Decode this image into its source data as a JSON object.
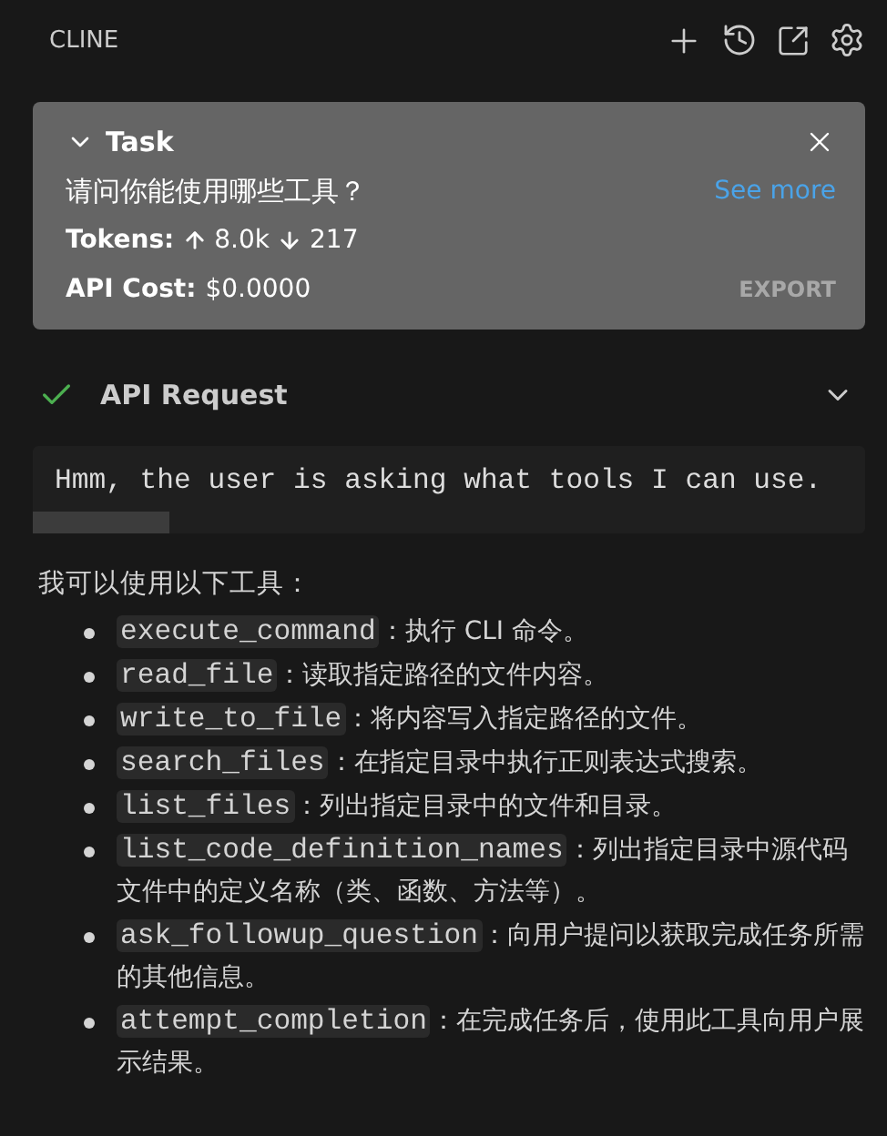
{
  "header": {
    "title": "CLINE"
  },
  "task": {
    "title": "Task",
    "expanded": true,
    "question": "请问你能使用哪些工具？",
    "see_more": "See more",
    "tokens": {
      "label": "Tokens:",
      "up": "8.0k",
      "down": "217"
    },
    "cost": {
      "label": "API Cost:",
      "value": "$0.0000"
    },
    "export": "EXPORT"
  },
  "api_request": {
    "title": "API Request",
    "done": true,
    "expanded": false,
    "thinking": "Hmm, the user is asking what tools I can use."
  },
  "answer": {
    "intro": "我可以使用以下工具：",
    "tools": [
      {
        "name": "execute_command",
        "description": "：执行 CLI 命令。"
      },
      {
        "name": "read_file",
        "description": "：读取指定路径的文件内容。"
      },
      {
        "name": "write_to_file",
        "description": "：将内容写入指定路径的文件。"
      },
      {
        "name": "search_files",
        "description": "：在指定目录中执行正则表达式搜索。"
      },
      {
        "name": "list_files",
        "description": "：列出指定目录中的文件和目录。"
      },
      {
        "name": "list_code_definition_names",
        "description": "：列出指定目录中源代码文件中的定义名称（类、函数、方法等）。"
      },
      {
        "name": "ask_followup_question",
        "description": "：向用户提问以获取完成任务所需的其他信息。"
      },
      {
        "name": "attempt_completion",
        "description": "：在完成任务后，使用此工具向用户展示结果。"
      }
    ]
  }
}
